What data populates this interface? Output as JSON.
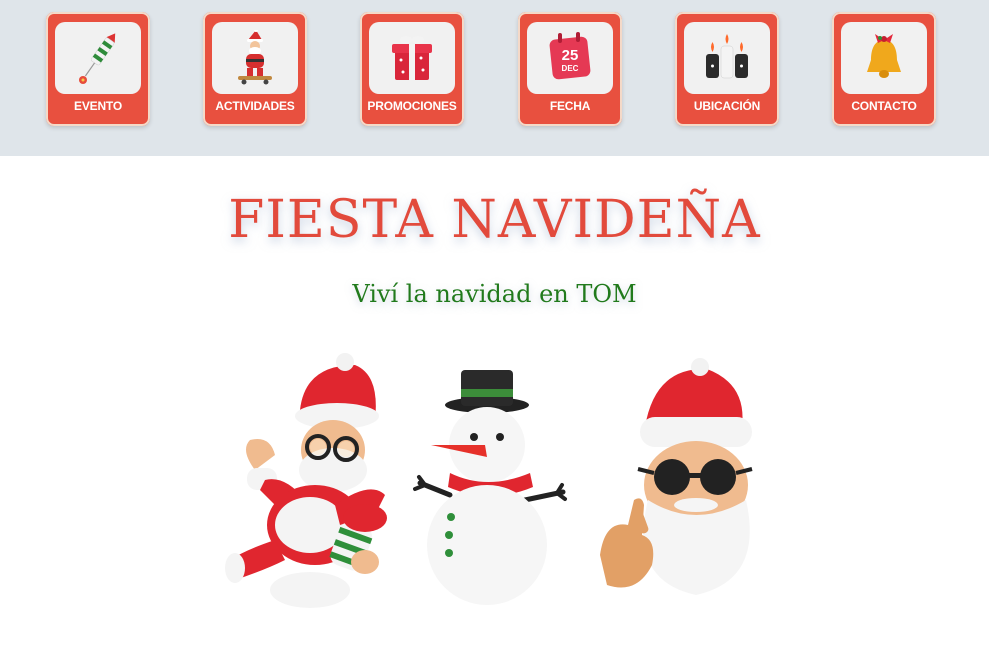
{
  "nav": {
    "items": [
      {
        "label": "EVENTO",
        "icon": "firework-rocket-icon"
      },
      {
        "label": "ACTIVIDADES",
        "icon": "santa-skateboard-icon"
      },
      {
        "label": "PROMOCIONES",
        "icon": "gift-box-icon"
      },
      {
        "label": "FECHA",
        "icon": "calendar-icon"
      },
      {
        "label": "UBICACIÓN",
        "icon": "candles-icon"
      },
      {
        "label": "CONTACTO",
        "icon": "bell-icon"
      }
    ],
    "calendar_day": "25",
    "calendar_month": "DEC"
  },
  "hero": {
    "title": "FIESTA NAVIDEÑA",
    "subtitle": "Viví la navidad en TOM"
  },
  "colors": {
    "accent": "#e8503f",
    "title": "#e24a3c",
    "subtitle": "#217a1c",
    "topbar": "#dfe5ea"
  }
}
